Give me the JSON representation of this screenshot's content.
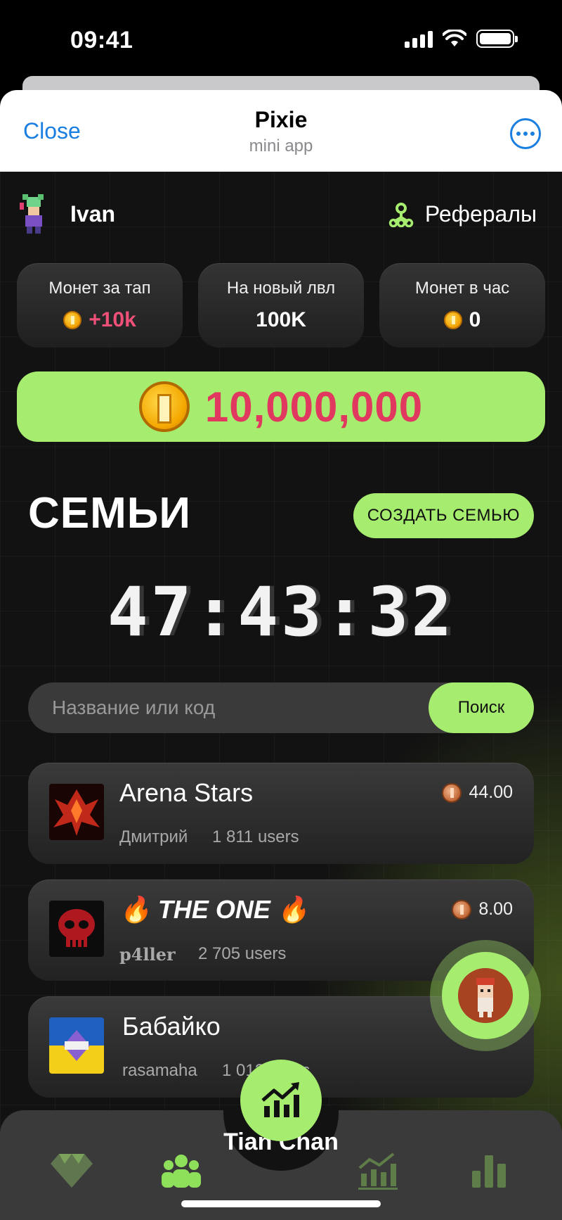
{
  "status_bar": {
    "time": "09:41"
  },
  "header": {
    "close_label": "Close",
    "title": "Pixie",
    "subtitle": "mini app"
  },
  "user": {
    "name": "Ivan"
  },
  "referrals": {
    "label": "Рефералы"
  },
  "stats": [
    {
      "label": "Монет за тап",
      "value": "+10k",
      "icon": "coin-icon"
    },
    {
      "label": "На новый лвл",
      "value": "100K"
    },
    {
      "label": "Монет в час",
      "value": "0",
      "icon": "coin-icon"
    }
  ],
  "balance": {
    "value": "10,000,000"
  },
  "families": {
    "title": "СЕМЬИ",
    "create_label": "СОЗДАТЬ СЕМЬЮ",
    "timer": "47:43:32",
    "search_placeholder": "Название или код",
    "search_button": "Поиск",
    "items": [
      {
        "name": "Arena Stars",
        "owner": "Дмитрий",
        "users": "1 811 users",
        "score": "44.00"
      },
      {
        "name": "🔥 THE ONE 🔥",
        "owner": "p4ller",
        "users": "2 705 users",
        "score": "8.00"
      },
      {
        "name": "Бабайко",
        "owner": "rasamaha",
        "users": "1 012 users",
        "score": ""
      }
    ]
  },
  "nav": {
    "center_label": "Tian Chan",
    "items": [
      "diamond-icon",
      "family-icon",
      "stats-chart-icon",
      "bar-chart-icon"
    ]
  },
  "colors": {
    "accent_green": "#a6ec6e",
    "pink": "#e0385e",
    "link_blue": "#1a7fe0"
  }
}
